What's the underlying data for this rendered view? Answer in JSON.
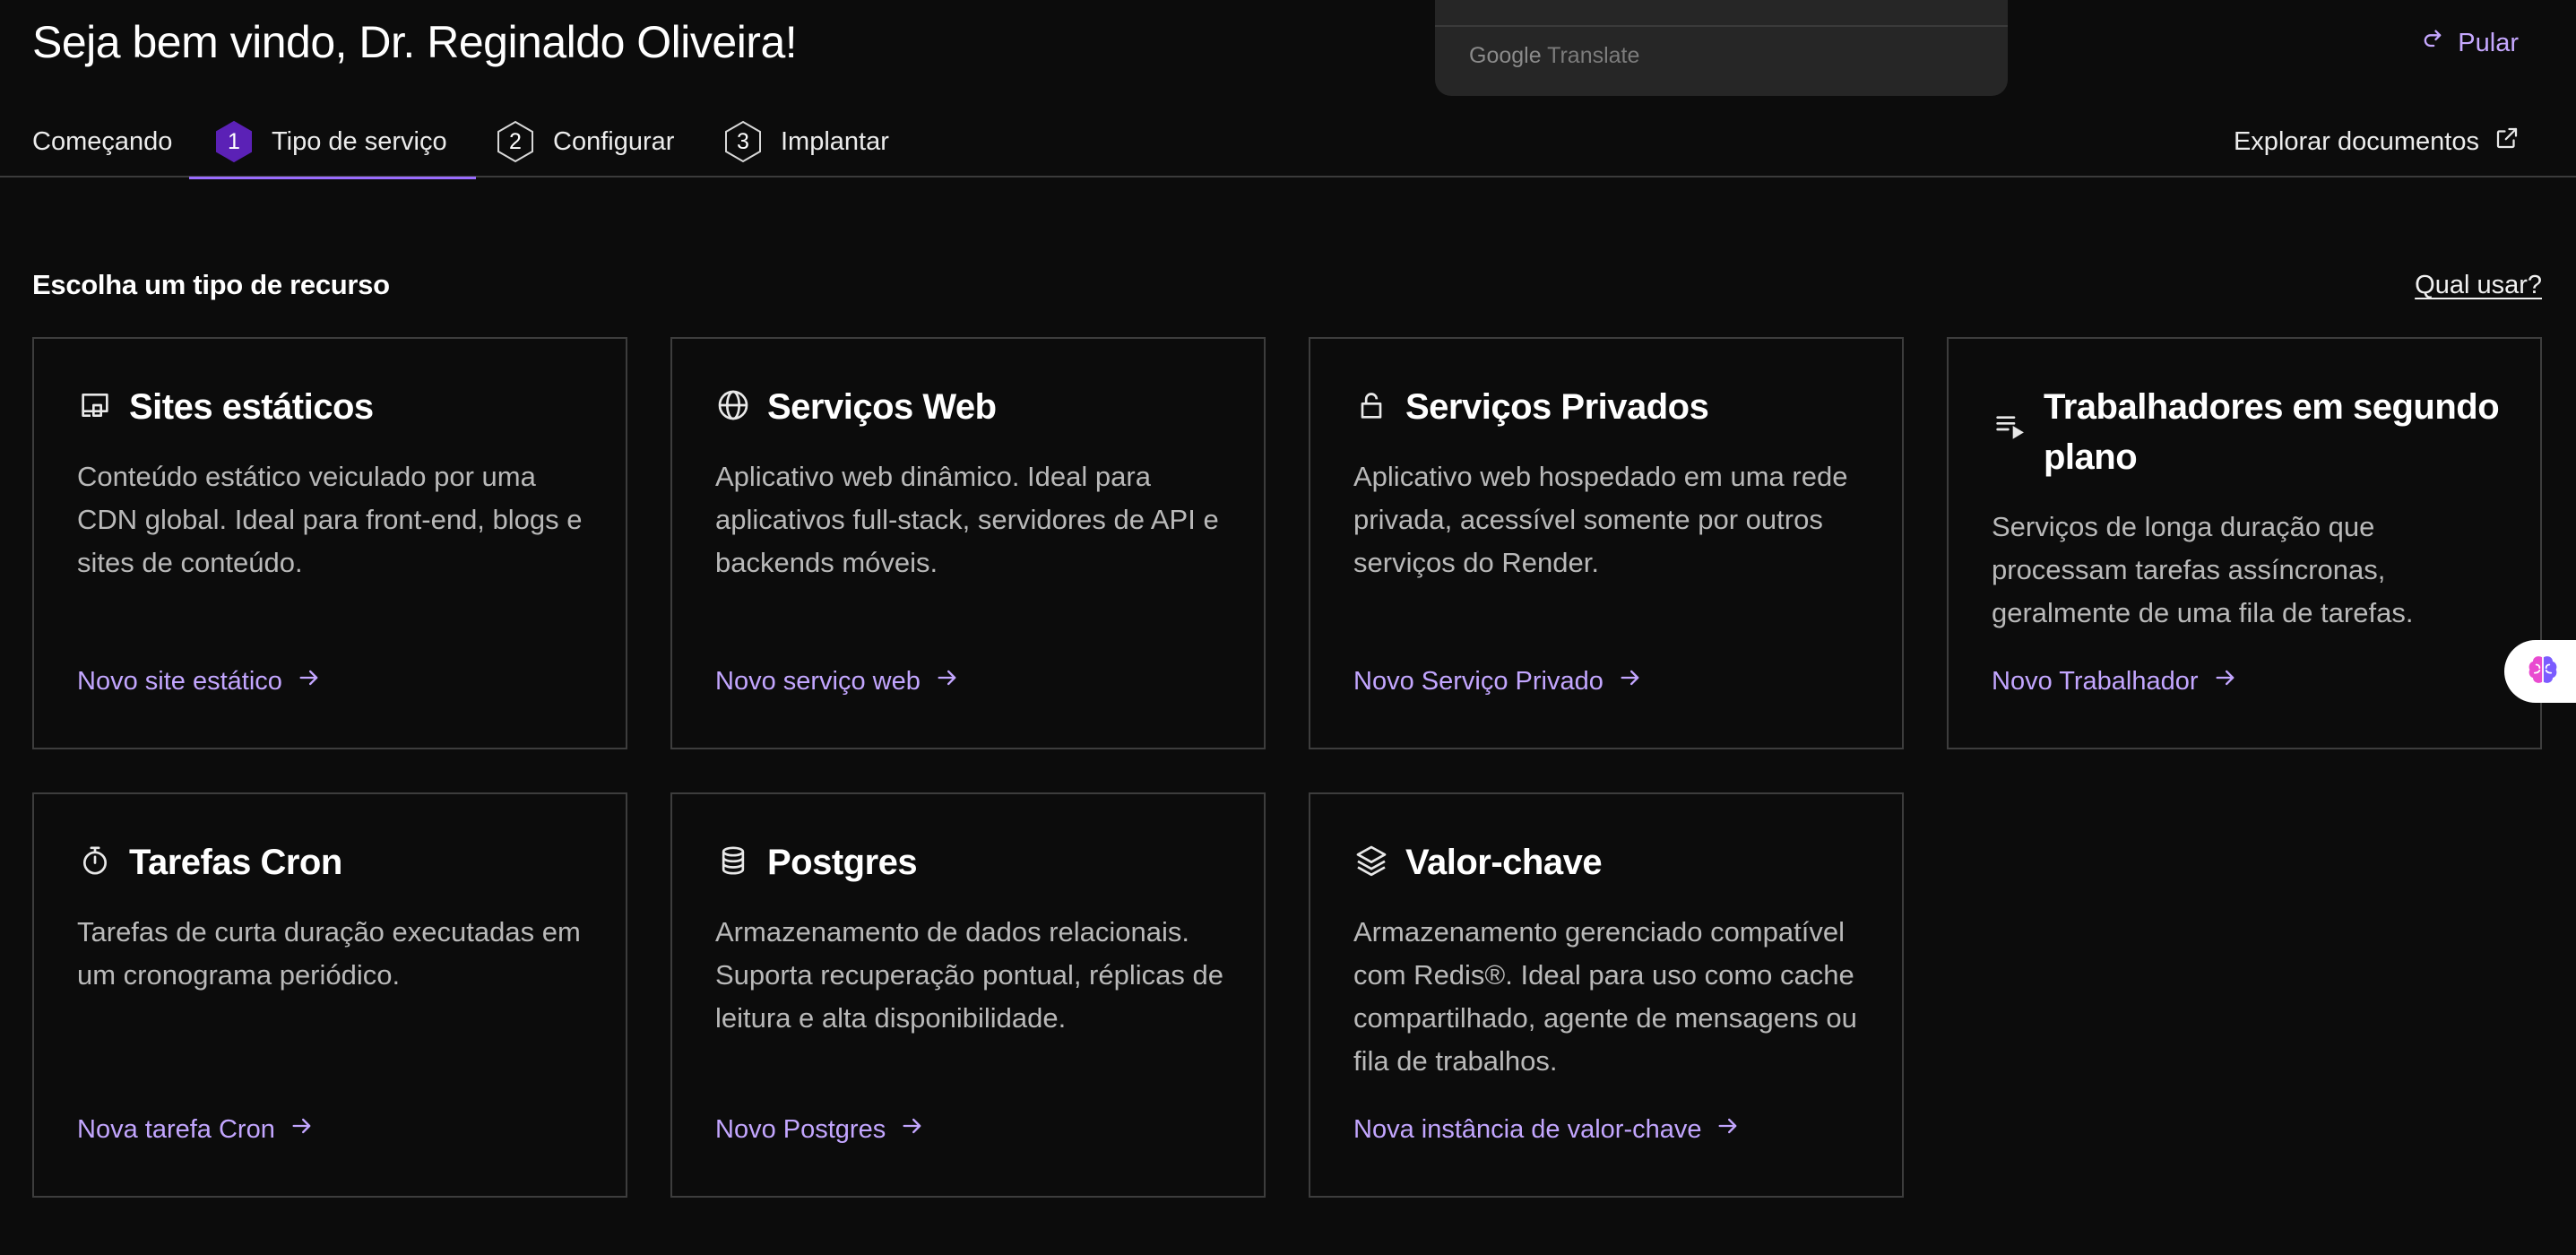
{
  "header": {
    "title": "Seja bem vindo, Dr. Reginaldo Oliveira!",
    "skip_label": "Pular"
  },
  "translate_popup": {
    "brand_google": "Google",
    "brand_translate": "Translate"
  },
  "tabs": [
    {
      "label": "Começando",
      "step": ""
    },
    {
      "label": "Tipo de serviço",
      "step": "1",
      "active": true
    },
    {
      "label": "Configurar",
      "step": "2"
    },
    {
      "label": "Implantar",
      "step": "3"
    }
  ],
  "docs_link": {
    "label": "Explorar documentos",
    "icon": "external-link-icon"
  },
  "section": {
    "title": "Escolha um tipo de recurso",
    "help_link": "Qual usar?"
  },
  "cards": [
    {
      "icon": "static-site-icon",
      "title": "Sites estáticos",
      "description": "Conteúdo estático veiculado por uma CDN global. Ideal para front-end, blogs e sites de conteúdo.",
      "link": "Novo site estático"
    },
    {
      "icon": "globe-icon",
      "title": "Serviços Web",
      "description": "Aplicativo web dinâmico. Ideal para aplicativos full-stack, servidores de API e backends móveis.",
      "link": "Novo serviço web"
    },
    {
      "icon": "lock-icon",
      "title": "Serviços Privados",
      "description": "Aplicativo web hospedado em uma rede privada, acessível somente por outros serviços do Render.",
      "link": "Novo Serviço Privado"
    },
    {
      "icon": "queue-icon",
      "title": "Trabalhadores em segundo plano",
      "description": "Serviços de longa duração que processam tarefas assíncronas, geralmente de uma fila de tarefas.",
      "link": "Novo Trabalhador"
    },
    {
      "icon": "stopwatch-icon",
      "title": "Tarefas Cron",
      "description": "Tarefas de curta duração executadas em um cronograma periódico.",
      "link": "Nova tarefa Cron"
    },
    {
      "icon": "database-icon",
      "title": "Postgres",
      "description": "Armazenamento de dados relacionais. Suporta recuperação pontual, réplicas de leitura e alta disponibilidade.",
      "link": "Novo Postgres"
    },
    {
      "icon": "layers-icon",
      "title": "Valor-chave",
      "description": "Armazenamento gerenciado compatível com Redis®. Ideal para uso como cache compartilhado, agente de mensagens ou fila de trabalhos.",
      "link": "Nova instância de valor-chave"
    }
  ],
  "widgets": {
    "brain": "brain-icon"
  },
  "colors": {
    "background": "#0c0c0c",
    "accent": "#c3a6ff",
    "active_step": "#5b21b6",
    "border": "#3d3d3d"
  }
}
